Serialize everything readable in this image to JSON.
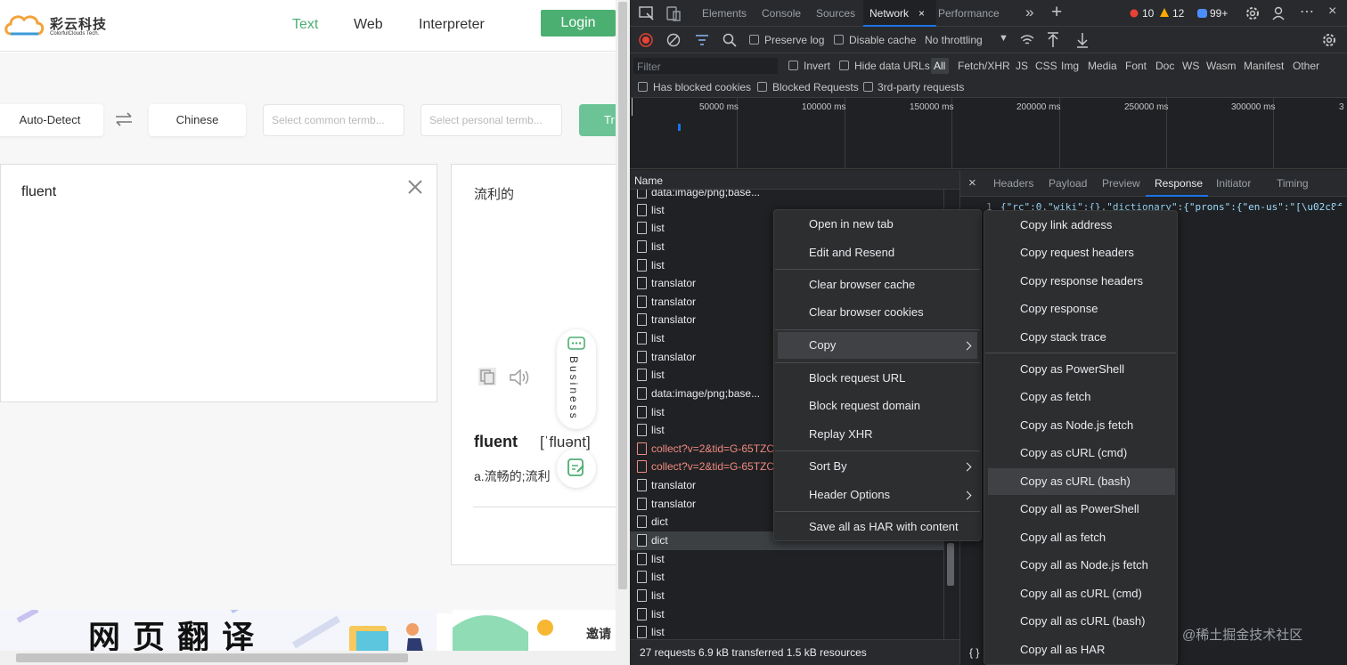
{
  "site": {
    "logo_name": "彩云科技",
    "logo_sub": "ColorfulClouds Tech.",
    "nav": [
      "Text",
      "Web",
      "Interpreter"
    ],
    "login": "Login",
    "source_lang": "Auto-Detect",
    "target_lang": "Chinese",
    "common_termbase_placeholder": "Select common termb...",
    "personal_termbase_placeholder": "Select personal termb...",
    "translate_btn": "Tr",
    "input_text": "fluent",
    "output_text": "流利的",
    "business_label": "Business",
    "dict_word": "fluent",
    "dict_phonetic": "[ˈfluənt]",
    "dict_meaning": "a.流畅的;流利",
    "banner_text": "网页翻译",
    "banner2_text": "邀请",
    "accent_color": "#4caf72"
  },
  "devtools": {
    "tabs": [
      "Elements",
      "Console",
      "Sources",
      "Network",
      "Performance"
    ],
    "errors": "10",
    "warnings": "12",
    "info": "99+",
    "preserve_log": "Preserve log",
    "disable_cache": "Disable cache",
    "throttling": "No throttling",
    "filter_placeholder": "Filter",
    "invert": "Invert",
    "hide_data_urls": "Hide data URLs",
    "types": [
      "All",
      "Fetch/XHR",
      "JS",
      "CSS",
      "Img",
      "Media",
      "Font",
      "Doc",
      "WS",
      "Wasm",
      "Manifest",
      "Other"
    ],
    "has_blocked_cookies": "Has blocked cookies",
    "blocked_requests": "Blocked Requests",
    "third_party": "3rd-party requests",
    "ticks": [
      "50000 ms",
      "100000 ms",
      "150000 ms",
      "200000 ms",
      "250000 ms",
      "300000 ms",
      "3"
    ],
    "name_header": "Name",
    "requests": [
      "data:image/png;base...",
      "list",
      "list",
      "list",
      "list",
      "translator",
      "translator",
      "translator",
      "list",
      "translator",
      "list",
      "data:image/png;base...",
      "list",
      "list",
      "collect?v=2&tid=G-65TZC",
      "collect?v=2&tid=G-65TZC",
      "translator",
      "translator",
      "dict",
      "dict",
      "list",
      "list",
      "list",
      "list",
      "list"
    ],
    "status": "27 requests  6.9 kB transferred  1.5 kB resources",
    "detail_tabs": [
      "Headers",
      "Payload",
      "Preview",
      "Response",
      "Initiator",
      "Timing"
    ],
    "line_number": "1",
    "response_line": "{\"rc\":0,\"wiki\":{},\"dictionary\":{\"prons\":{\"en-us\":\"[\\u02c8f",
    "bottom_brace": "{ }"
  },
  "context_menu": {
    "items": [
      "Open in new tab",
      "Edit and Resend",
      "Clear browser cache",
      "Clear browser cookies",
      "Copy",
      "Block request URL",
      "Block request domain",
      "Replay XHR",
      "Sort By",
      "Header Options",
      "Save all as HAR with content"
    ]
  },
  "copy_submenu": {
    "items": [
      "Copy link address",
      "Copy request headers",
      "Copy response headers",
      "Copy response",
      "Copy stack trace",
      "Copy as PowerShell",
      "Copy as fetch",
      "Copy as Node.js fetch",
      "Copy as cURL (cmd)",
      "Copy as cURL (bash)",
      "Copy all as PowerShell",
      "Copy all as fetch",
      "Copy all as Node.js fetch",
      "Copy all as cURL (cmd)",
      "Copy all as cURL (bash)",
      "Copy all as HAR"
    ]
  },
  "watermark": "@稀土掘金技术社区"
}
